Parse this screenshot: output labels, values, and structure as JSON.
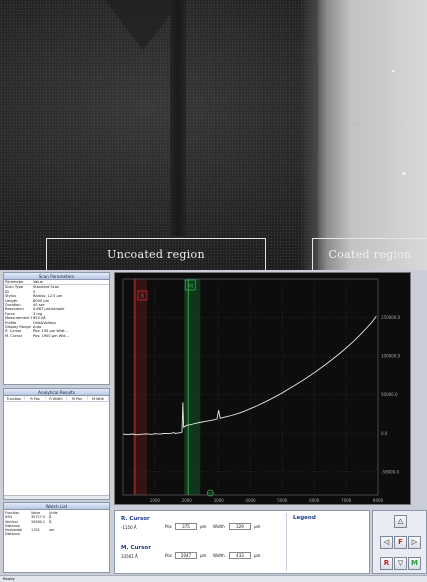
{
  "image": {
    "uncoated_label": "Uncoated region",
    "coated_label": "Coated region"
  },
  "scan_parameters": {
    "title": "Scan Parameters",
    "header": [
      "Parameter",
      "Value"
    ],
    "rows": [
      [
        "Scan Type",
        "Standard Scan"
      ],
      [
        "ID",
        "0"
      ],
      [
        "Stylus",
        "Radius: 12.5 µm"
      ],
      [
        "Length",
        "8000 µm"
      ],
      [
        "Duration",
        "40 sec"
      ],
      [
        "Resolution",
        "0.667 µm/sample"
      ],
      [
        "Force",
        "3 mg"
      ],
      [
        "Measurement Range",
        "655 kÅ"
      ],
      [
        "Profile",
        "Hills&Valleys"
      ],
      [
        "Display Range",
        "Auto"
      ],
      [
        "R. Cursor",
        "Pos: 130 µm Widt..."
      ],
      [
        "M. Cursor",
        "Pos: 1900 µm Wid..."
      ]
    ]
  },
  "analytical_results": {
    "title": "Analytical Results",
    "columns": [
      "Function",
      "R Pos",
      "R Width",
      "M Pos",
      "M Widt"
    ]
  },
  "watch_list": {
    "title": "Watch List",
    "header": [
      "Function",
      "Value",
      "Units"
    ],
    "rows": [
      [
        "ASH",
        "35717.0",
        "Å"
      ],
      [
        "Vertical Distance",
        "34560.1",
        "Å"
      ],
      [
        "Horizontal Distance",
        "1702",
        "um"
      ]
    ]
  },
  "chart_data": {
    "type": "line",
    "x_ticks": [
      "1000",
      "2000",
      "3000",
      "4000",
      "5000",
      "6000",
      "7000",
      "8000"
    ],
    "y_ticks": [
      "150000.0",
      "100000.0",
      "50000.0",
      "0.0",
      "-50000.0"
    ],
    "cursor_r_label": "R",
    "cursor_m_label": "M",
    "xlim": [
      0,
      8000
    ],
    "ylim": [
      -80000,
      200000
    ],
    "grid": true,
    "x": [
      0,
      150,
      300,
      450,
      600,
      750,
      900,
      1000,
      1150,
      1300,
      1500,
      1600,
      1650,
      1700,
      1800,
      1850,
      1880,
      1900,
      1950,
      2000,
      2100,
      2200,
      2400,
      2600,
      2800,
      2950,
      3000,
      3050,
      3200,
      3400,
      3600,
      3800,
      4000,
      4200,
      4400,
      4600,
      4800,
      5000,
      5200,
      5400,
      5600,
      5800,
      6000,
      6200,
      6400,
      6600,
      6800,
      7000,
      7200,
      7400,
      7600,
      7800,
      7950
    ],
    "y": [
      -1000,
      -1800,
      -900,
      -2000,
      -1200,
      -800,
      -1500,
      -600,
      -1000,
      -300,
      -200,
      1000,
      -500,
      300,
      800,
      1500,
      40000,
      8000,
      9000,
      10500,
      11000,
      12000,
      14000,
      15500,
      17000,
      18500,
      30000,
      19500,
      21000,
      23000,
      25500,
      28500,
      32000,
      35500,
      39500,
      43500,
      48000,
      52500,
      57500,
      62500,
      67500,
      73000,
      78500,
      84500,
      90500,
      97000,
      103500,
      110500,
      118000,
      126000,
      134500,
      143500,
      152000
    ]
  },
  "cursor_panel": {
    "r_title": "R. Cursor",
    "r_value": "-1150 Å",
    "r_pos": "375",
    "r_width": "329",
    "m_title": "M. Cursor",
    "m_value": "33561 Å",
    "m_pos": "2047",
    "m_width": "433",
    "pos_label": "Pos",
    "width_label": "Width",
    "unit": "µm"
  },
  "legend": {
    "title": "Legend"
  },
  "nav": {
    "up": "△",
    "down": "▽",
    "left": "◁",
    "right": "▷",
    "f": "F",
    "r": "R",
    "m": "M"
  },
  "status": {
    "text": "Ready"
  },
  "colors": {
    "trace": "#e8e8e8",
    "cursor_r": "#c43030",
    "cursor_m": "#2fb04a",
    "grid": "#3a3a3a"
  }
}
